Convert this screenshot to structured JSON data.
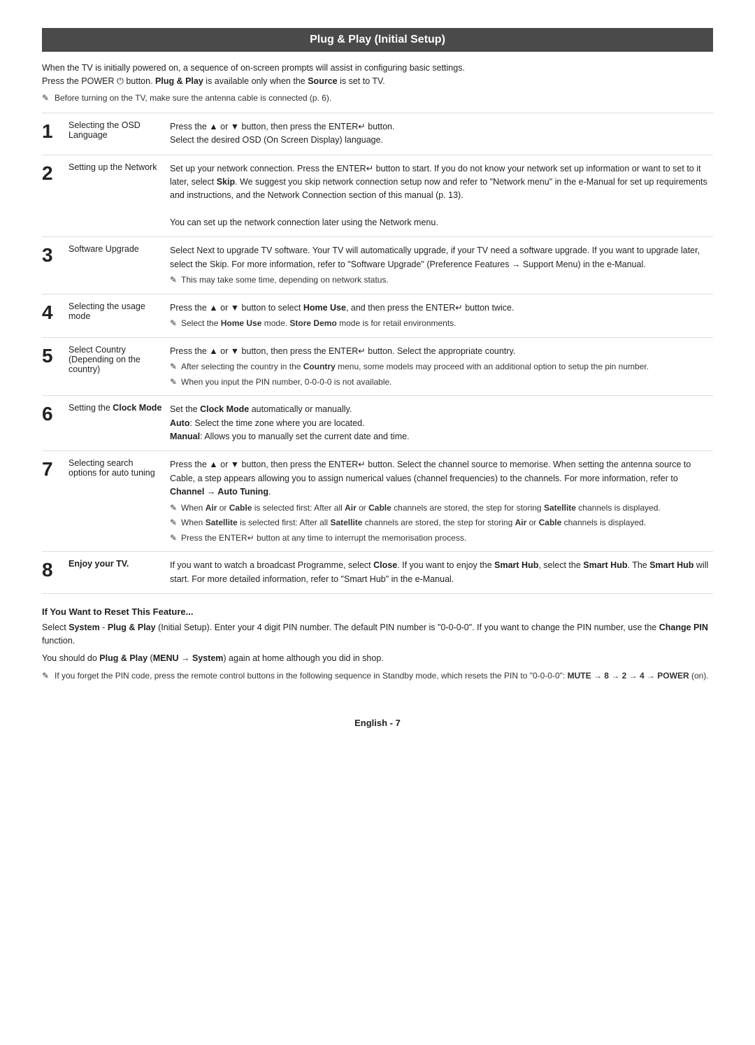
{
  "page": {
    "title": "Plug & Play (Initial Setup)",
    "intro": [
      "When the TV is initially powered on, a sequence of on-screen prompts will assist in configuring basic settings.",
      "Press the POWER ⏻ button. Plug & Play is available only when the Source is set to TV."
    ],
    "intro_note": "Before turning on the TV, make sure the antenna cable is connected (p. 6).",
    "steps": [
      {
        "num": "1",
        "label": "Selecting the OSD Language",
        "content_lines": [
          "Press the ▲ or ▼ button, then press the ENTER↵ button.",
          "Select the desired OSD (On Screen Display) language."
        ],
        "notes": []
      },
      {
        "num": "2",
        "label": "Setting up the Network",
        "content_lines": [
          "Set up your network connection. Press the ENTER↵ button to start. If you do not know your network set up information or want to set to it later, select Skip. We suggest you skip network connection setup now and refer to “Network menu” in the e-Manual for set up requirements and instructions, and the Network Connection section of this manual (p. 13).",
          "You can set up the network connection later using the Network menu."
        ],
        "notes": []
      },
      {
        "num": "3",
        "label": "Software Upgrade",
        "content_lines": [
          "Select Next to upgrade TV software. Your TV will automatically upgrade, if your TV need a software upgrade. If you want to upgrade later, select the Skip. For more information, refer to “Software Upgrade” (Preference Features → Support Menu) in the e-Manual."
        ],
        "notes": [
          "This may take some time, depending on network status."
        ]
      },
      {
        "num": "4",
        "label": "Selecting the usage mode",
        "content_lines": [
          "Press the ▲ or ▼ button to select Home Use, and then press the ENTER↵ button twice."
        ],
        "notes": [
          "Select the Home Use mode. Store Demo mode is for retail environments."
        ]
      },
      {
        "num": "5",
        "label": "Select Country (Depending on the country)",
        "content_lines": [
          "Press the ▲ or ▼ button, then press the ENTER↵ button. Select the appropriate country."
        ],
        "notes": [
          "After selecting the country in the Country menu, some models may proceed with an additional option to setup the pin number.",
          "When you input the PIN number, 0-0-0-0 is not available."
        ]
      },
      {
        "num": "6",
        "label": "Setting the Clock Mode",
        "content_lines": [
          "Set the Clock Mode automatically or manually.",
          "Auto: Select the time zone where you are located.",
          "Manual: Allows you to manually set the current date and time."
        ],
        "notes": []
      },
      {
        "num": "7",
        "label": "Selecting search options for auto tuning",
        "content_lines": [
          "Press the ▲ or ▼ button, then press the ENTER↵ button. Select the channel source to memorise. When setting the antenna source to Cable, a step appears allowing you to assign numerical values (channel frequencies) to the channels. For more information, refer to Channel → Auto Tuning."
        ],
        "notes": [
          "When Air or Cable is selected first: After all Air or Cable channels are stored, the step for storing Satellite channels is displayed.",
          "When Satellite is selected first: After all Satellite channels are stored, the step for storing Air or Cable channels is displayed.",
          "Press the ENTER↵ button at any time to interrupt the memorisation process."
        ]
      },
      {
        "num": "8",
        "label": "Enjoy your TV.",
        "content_lines": [
          "If you want to watch a broadcast Programme, select Close. If you want to enjoy the Smart Hub, select the Smart Hub. The Smart Hub will start. For more detailed information, refer to “Smart Hub” in the e-Manual."
        ],
        "notes": []
      }
    ],
    "reset_section": {
      "title": "If You Want to Reset This Feature...",
      "lines": [
        "Select System - Plug & Play (Initial Setup). Enter your 4 digit PIN number. The default PIN number is “0-0-0-0”. If you want to change the PIN number, use the Change PIN function.",
        "You should do Plug & Play (MENU → System) again at home although you did in shop."
      ],
      "footer_note": "If you forget the PIN code, press the remote control buttons in the following sequence in Standby mode, which resets the PIN to “0-0-0-0”: MUTE → 8 → 2 → 4 → POWER (on)."
    },
    "footer": "English - 7"
  }
}
